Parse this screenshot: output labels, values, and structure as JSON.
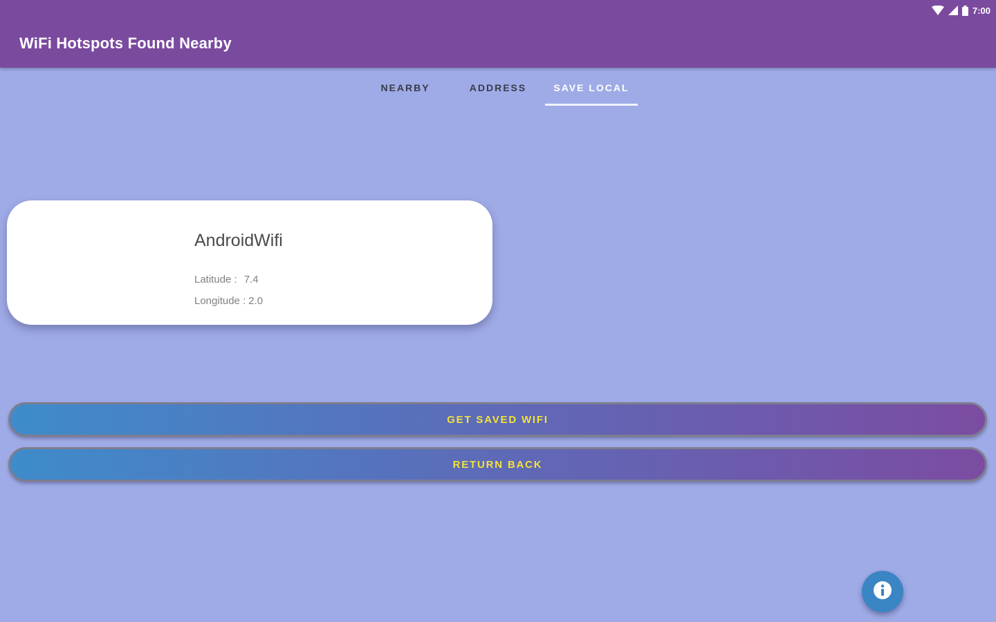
{
  "colors": {
    "app_bar": "#7A4A9F",
    "background": "#9FABE6",
    "button_text": "#F3E23A",
    "button_gradient_start": "#3E8CCB",
    "button_gradient_end": "#7B4CA2",
    "fab": "#3A85C4"
  },
  "status_bar": {
    "time": "7:00",
    "icons": [
      "wifi-icon",
      "signal-icon",
      "battery-icon"
    ]
  },
  "app_bar": {
    "title": "WiFi Hotspots Found Nearby"
  },
  "tabs": [
    {
      "label": "NEARBY",
      "active": false
    },
    {
      "label": "ADDRESS",
      "active": false
    },
    {
      "label": "SAVE LOCAL",
      "active": true
    }
  ],
  "card": {
    "name": "AndroidWifi",
    "latitude_label": "Latitude :",
    "latitude_value": "7.4",
    "longitude_label": "Longitude :",
    "longitude_value": "2.0"
  },
  "buttons": {
    "get_saved": "GET SAVED WIFI",
    "return_back": "RETURN BACK"
  },
  "fab": {
    "icon": "info-icon"
  }
}
